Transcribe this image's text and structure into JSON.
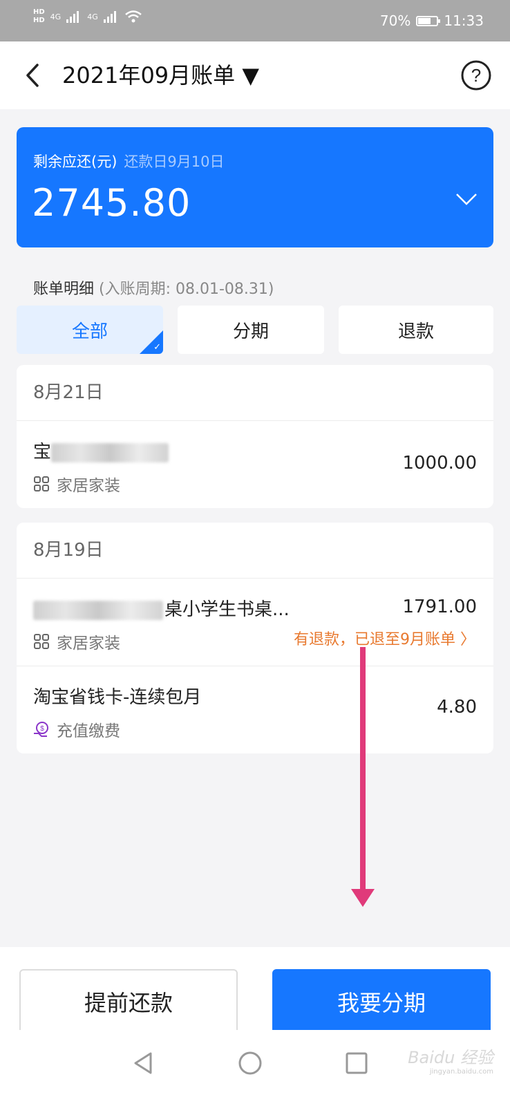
{
  "status_bar": {
    "hd_top": "HD",
    "hd_bottom": "HD",
    "signal_1": "4G",
    "signal_2": "4G",
    "battery": "70%",
    "battery_level": 0.7,
    "time": "11:33"
  },
  "header": {
    "title": "2021年09月账单 ▼"
  },
  "summary": {
    "label": "剩余应还(元)",
    "due_date": "还款日9月10日",
    "amount": "2745.80"
  },
  "details": {
    "title": "账单明细",
    "period": "(入账周期: 08.01-08.31)"
  },
  "tabs": [
    {
      "label": "全部",
      "active": true
    },
    {
      "label": "分期",
      "active": false
    },
    {
      "label": "退款",
      "active": false
    }
  ],
  "groups": [
    {
      "date": "8月21日",
      "transactions": [
        {
          "name": "宝",
          "category": "家居家装",
          "amount": "1000.00",
          "note": ""
        }
      ]
    },
    {
      "date": "8月19日",
      "transactions": [
        {
          "name": "桌小学生书桌...",
          "category": "家居家装",
          "amount": "1791.00",
          "note": "有退款，已退至9月账单 〉"
        },
        {
          "name": "淘宝省钱卡-连续包月",
          "category": "充值缴费",
          "amount": "4.80",
          "note": ""
        }
      ]
    }
  ],
  "actions": {
    "prepay": "提前还款",
    "installment": "我要分期"
  },
  "watermark": {
    "text": "Baidu 经验",
    "sub": "jingyan.baidu.com"
  },
  "colors": {
    "accent": "#1677ff",
    "refund_note": "#e8792f",
    "annotation_arrow": "#e03a7a"
  }
}
